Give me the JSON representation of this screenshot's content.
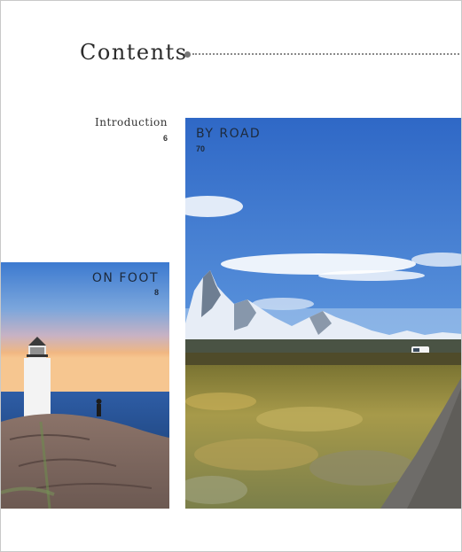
{
  "header": {
    "title": "Contents"
  },
  "entries": {
    "introduction": {
      "label": "Introduction",
      "page": "6"
    },
    "by_road": {
      "label": "BY ROAD",
      "page": "70",
      "image": "mountain-road-photo"
    },
    "on_foot": {
      "label": "ON FOOT",
      "page": "8",
      "image": "lighthouse-photo"
    }
  }
}
